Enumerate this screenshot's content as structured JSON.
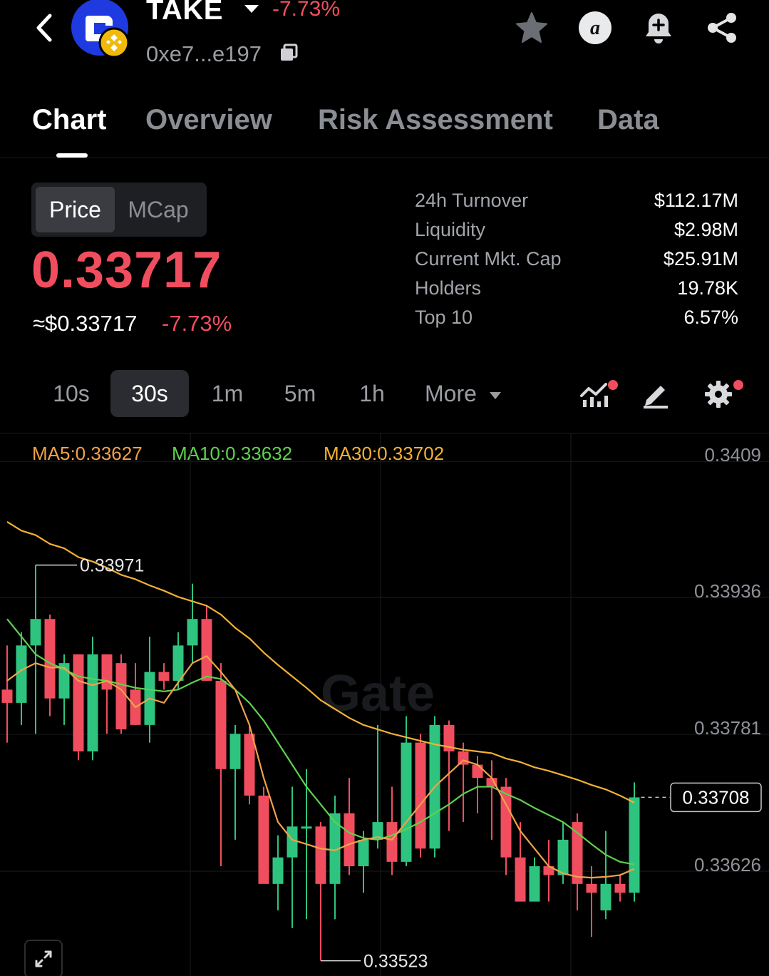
{
  "header": {
    "token_name": "TAKE",
    "token_change": "-7.73%",
    "address": "0xe7...e197"
  },
  "icons": {
    "back": "chevron-left-icon",
    "copy": "copy-icon",
    "favorite": "star-icon",
    "alpha": "alpha-icon",
    "alert": "bell-plus-icon",
    "share": "share-icon",
    "indicators": "indicator-chart-icon",
    "draw": "pencil-icon",
    "settings": "gear-icon",
    "expand": "expand-icon"
  },
  "tabs": [
    {
      "label": "Chart"
    },
    {
      "label": "Overview"
    },
    {
      "label": "Risk Assessment"
    },
    {
      "label": "Data"
    }
  ],
  "toggle": {
    "price": "Price",
    "mcap": "MCap"
  },
  "price": {
    "value": "0.33717",
    "usd": "≈$0.33717",
    "change": "-7.73%"
  },
  "stats": [
    {
      "label": "24h Turnover",
      "value": "$112.17M"
    },
    {
      "label": "Liquidity",
      "value": "$2.98M"
    },
    {
      "label": "Current Mkt. Cap",
      "value": "$25.91M"
    },
    {
      "label": "Holders",
      "value": "19.78K"
    },
    {
      "label": "Top 10",
      "value": "6.57%"
    }
  ],
  "intervals": [
    "10s",
    "30s",
    "1m",
    "5m",
    "1h"
  ],
  "more_label": "More",
  "colors": {
    "up": "#2ec47f",
    "down": "#f04e5e",
    "ma5": "#f0a24a",
    "ma10": "#5fd14f",
    "ma30": "#f5b133",
    "background": "#000000"
  },
  "watermark": "Gate",
  "chart_data": {
    "type": "candlestick",
    "ma_legend": [
      {
        "label": "MA5:0.33627",
        "color": "#f0a24a"
      },
      {
        "label": "MA10:0.33632",
        "color": "#5fd14f"
      },
      {
        "label": "MA30:0.33702",
        "color": "#f5b133"
      }
    ],
    "y_ticks": [
      "0.3409",
      "0.33936",
      "0.33781",
      "0.33626"
    ],
    "y_tick_values": [
      0.3409,
      0.33936,
      0.33781,
      0.33626
    ],
    "high_label": "0.33971",
    "low_label": "0.33523",
    "last_price_label": "0.33708",
    "last_price": 0.33708,
    "candles": [
      {
        "o": 0.3383,
        "h": 0.3388,
        "l": 0.3377,
        "c": 0.33815
      },
      {
        "o": 0.33815,
        "h": 0.33895,
        "l": 0.3379,
        "c": 0.3388
      },
      {
        "o": 0.3388,
        "h": 0.33971,
        "l": 0.3378,
        "c": 0.3391
      },
      {
        "o": 0.3391,
        "h": 0.33915,
        "l": 0.338,
        "c": 0.3382
      },
      {
        "o": 0.3382,
        "h": 0.3387,
        "l": 0.3379,
        "c": 0.3386
      },
      {
        "o": 0.3387,
        "h": 0.3387,
        "l": 0.3375,
        "c": 0.3376
      },
      {
        "o": 0.3376,
        "h": 0.3389,
        "l": 0.3375,
        "c": 0.3387
      },
      {
        "o": 0.3387,
        "h": 0.3387,
        "l": 0.3378,
        "c": 0.3383
      },
      {
        "o": 0.3386,
        "h": 0.3387,
        "l": 0.3378,
        "c": 0.33785
      },
      {
        "o": 0.3383,
        "h": 0.3386,
        "l": 0.3379,
        "c": 0.3379
      },
      {
        "o": 0.3379,
        "h": 0.3389,
        "l": 0.3377,
        "c": 0.3385
      },
      {
        "o": 0.3385,
        "h": 0.3386,
        "l": 0.3383,
        "c": 0.3384
      },
      {
        "o": 0.3384,
        "h": 0.33895,
        "l": 0.3383,
        "c": 0.3388
      },
      {
        "o": 0.3388,
        "h": 0.3395,
        "l": 0.3386,
        "c": 0.3391
      },
      {
        "o": 0.3391,
        "h": 0.33925,
        "l": 0.3384,
        "c": 0.3384
      },
      {
        "o": 0.3384,
        "h": 0.3386,
        "l": 0.3363,
        "c": 0.3374
      },
      {
        "o": 0.3374,
        "h": 0.3379,
        "l": 0.3366,
        "c": 0.3378
      },
      {
        "o": 0.3378,
        "h": 0.3379,
        "l": 0.337,
        "c": 0.3371
      },
      {
        "o": 0.3371,
        "h": 0.3372,
        "l": 0.3365,
        "c": 0.3361
      },
      {
        "o": 0.3361,
        "h": 0.33665,
        "l": 0.3358,
        "c": 0.3364
      },
      {
        "o": 0.3364,
        "h": 0.3372,
        "l": 0.3356,
        "c": 0.33675
      },
      {
        "o": 0.33675,
        "h": 0.3374,
        "l": 0.3357,
        "c": 0.33675
      },
      {
        "o": 0.33675,
        "h": 0.3368,
        "l": 0.33523,
        "c": 0.3361
      },
      {
        "o": 0.3361,
        "h": 0.3371,
        "l": 0.3357,
        "c": 0.3369
      },
      {
        "o": 0.3369,
        "h": 0.3373,
        "l": 0.3362,
        "c": 0.3363
      },
      {
        "o": 0.3363,
        "h": 0.3367,
        "l": 0.336,
        "c": 0.3366
      },
      {
        "o": 0.3366,
        "h": 0.3379,
        "l": 0.3365,
        "c": 0.3368
      },
      {
        "o": 0.3368,
        "h": 0.3372,
        "l": 0.3362,
        "c": 0.33635
      },
      {
        "o": 0.33635,
        "h": 0.338,
        "l": 0.3363,
        "c": 0.3377
      },
      {
        "o": 0.3377,
        "h": 0.3378,
        "l": 0.3364,
        "c": 0.3365
      },
      {
        "o": 0.3365,
        "h": 0.338,
        "l": 0.3364,
        "c": 0.3379
      },
      {
        "o": 0.3379,
        "h": 0.33795,
        "l": 0.3367,
        "c": 0.3376
      },
      {
        "o": 0.3376,
        "h": 0.3377,
        "l": 0.3368,
        "c": 0.33745
      },
      {
        "o": 0.33745,
        "h": 0.33755,
        "l": 0.3369,
        "c": 0.3373
      },
      {
        "o": 0.3373,
        "h": 0.3375,
        "l": 0.3366,
        "c": 0.3372
      },
      {
        "o": 0.3372,
        "h": 0.3373,
        "l": 0.3362,
        "c": 0.3364
      },
      {
        "o": 0.3364,
        "h": 0.3368,
        "l": 0.3359,
        "c": 0.3359
      },
      {
        "o": 0.3359,
        "h": 0.3364,
        "l": 0.3359,
        "c": 0.3363
      },
      {
        "o": 0.3363,
        "h": 0.3366,
        "l": 0.3359,
        "c": 0.3362
      },
      {
        "o": 0.3362,
        "h": 0.3368,
        "l": 0.3361,
        "c": 0.3366
      },
      {
        "o": 0.3368,
        "h": 0.3369,
        "l": 0.3358,
        "c": 0.3361
      },
      {
        "o": 0.3361,
        "h": 0.3363,
        "l": 0.3355,
        "c": 0.336
      },
      {
        "o": 0.3358,
        "h": 0.3367,
        "l": 0.3357,
        "c": 0.3361
      },
      {
        "o": 0.3361,
        "h": 0.3362,
        "l": 0.3359,
        "c": 0.336
      },
      {
        "o": 0.336,
        "h": 0.33725,
        "l": 0.3359,
        "c": 0.33708
      }
    ],
    "ma5": [
      0.3384,
      0.33852,
      0.3386,
      0.33855,
      0.33855,
      0.3384,
      0.33835,
      0.3384,
      0.3383,
      0.3381,
      0.3382,
      0.33815,
      0.33838,
      0.3386,
      0.33868,
      0.3385,
      0.3383,
      0.3379,
      0.3373,
      0.3368,
      0.3366,
      0.33655,
      0.3365,
      0.33648,
      0.33655,
      0.3366,
      0.33663,
      0.3366,
      0.3368,
      0.337,
      0.3372,
      0.33735,
      0.3375,
      0.33745,
      0.3373,
      0.337,
      0.3367,
      0.3365,
      0.3363,
      0.33622,
      0.33618,
      0.33617,
      0.33618,
      0.3362,
      0.33627
    ],
    "ma10": [
      0.3391,
      0.3389,
      0.3387,
      0.3386,
      0.33853,
      0.33845,
      0.33842,
      0.3384,
      0.33836,
      0.33832,
      0.3383,
      0.33828,
      0.3383,
      0.33838,
      0.33845,
      0.33842,
      0.3383,
      0.33815,
      0.33795,
      0.3377,
      0.33745,
      0.3372,
      0.337,
      0.3368,
      0.33668,
      0.33662,
      0.3366,
      0.33665,
      0.33672,
      0.3368,
      0.3369,
      0.337,
      0.33712,
      0.3372,
      0.3372,
      0.33712,
      0.33705,
      0.33696,
      0.33688,
      0.3368,
      0.33668,
      0.33655,
      0.33643,
      0.33635,
      0.33632
    ],
    "ma30": [
      0.3402,
      0.3401,
      0.34005,
      0.33995,
      0.3399,
      0.3398,
      0.33975,
      0.33968,
      0.3396,
      0.33955,
      0.33948,
      0.33942,
      0.33935,
      0.3393,
      0.33925,
      0.33915,
      0.339,
      0.33888,
      0.33872,
      0.33858,
      0.33845,
      0.33832,
      0.33818,
      0.33808,
      0.33798,
      0.3379,
      0.33785,
      0.3378,
      0.33776,
      0.33772,
      0.33768,
      0.33765,
      0.33762,
      0.3376,
      0.33758,
      0.33752,
      0.33748,
      0.33742,
      0.33738,
      0.33733,
      0.33728,
      0.33722,
      0.33717,
      0.3371,
      0.33702
    ],
    "grid": true
  }
}
